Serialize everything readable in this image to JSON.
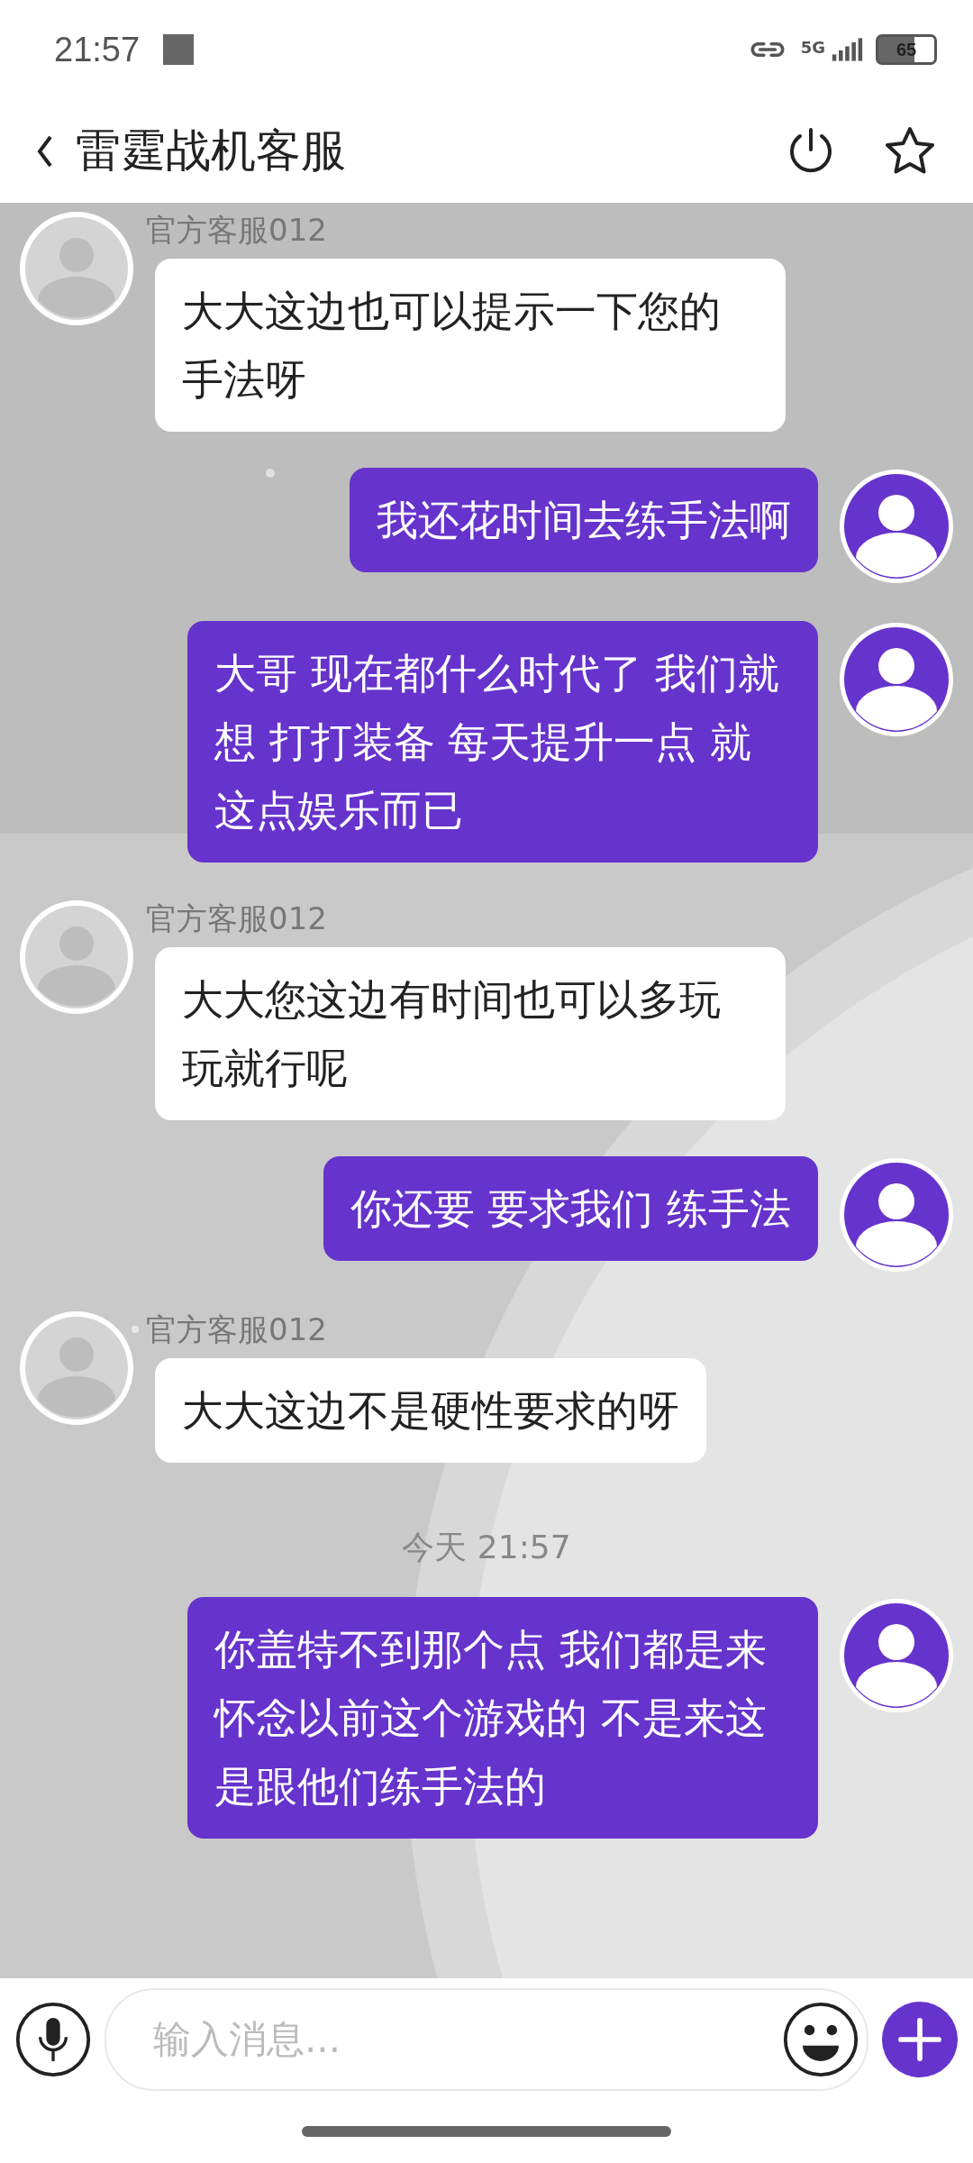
{
  "status_bar": {
    "time": "21:57",
    "network": "5G",
    "battery": "65"
  },
  "header": {
    "title": "雷霆战机客服"
  },
  "messages": [
    {
      "kind": "incoming",
      "sender": "官方客服012",
      "text": "大大这边也可以提示一下您的手法呀"
    },
    {
      "kind": "outgoing",
      "text": "我还花时间去练手法啊"
    },
    {
      "kind": "outgoing",
      "text": "大哥 现在都什么时代了  我们就想 打打装备 每天提升一点 就这点娱乐而已"
    },
    {
      "kind": "incoming",
      "sender": "官方客服012",
      "text": "大大您这边有时间也可以多玩玩就行呢"
    },
    {
      "kind": "outgoing",
      "text": "你还要 要求我们 练手法"
    },
    {
      "kind": "incoming",
      "sender": "官方客服012",
      "text": "大大这边不是硬性要求的呀"
    },
    {
      "kind": "timestamp",
      "text": "今天 21:57"
    },
    {
      "kind": "outgoing",
      "text": "你盖特不到那个点  我们都是来怀念以前这个游戏的 不是来这是跟他们练手法的"
    }
  ],
  "input": {
    "placeholder": "输入消息..."
  }
}
